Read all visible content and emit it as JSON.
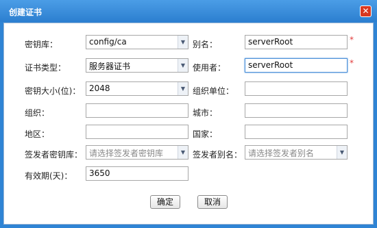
{
  "window": {
    "title": "创建证书"
  },
  "form": {
    "keystore": {
      "label": "密钥库：",
      "value": "config/ca"
    },
    "alias": {
      "label": "别名：",
      "value": "serverRoot",
      "required": "*"
    },
    "cert_type": {
      "label": "证书类型：",
      "value": "服务器证书"
    },
    "user": {
      "label": "使用者：",
      "value": "serverRoot",
      "required": "*"
    },
    "key_size": {
      "label": "密钥大小(位)：",
      "value": "2048"
    },
    "org_unit": {
      "label": "组织单位：",
      "value": ""
    },
    "org": {
      "label": "组织：",
      "value": ""
    },
    "city": {
      "label": "城市：",
      "value": ""
    },
    "region": {
      "label": "地区：",
      "value": ""
    },
    "country": {
      "label": "国家：",
      "value": ""
    },
    "issuer_keystore": {
      "label": "签发者密钥库：",
      "placeholder": "请选择签发者密钥库"
    },
    "issuer_alias": {
      "label": "签发者别名：",
      "placeholder": "请选择签发者别名"
    },
    "validity": {
      "label": "有效期(天)：",
      "value": "3650"
    }
  },
  "buttons": {
    "ok": "确定",
    "cancel": "取消"
  },
  "icons": {
    "close": "close-icon",
    "dropdown": "chevron-down-icon"
  },
  "colors": {
    "titlebar": "#2c7fd0",
    "required": "#e23a3a"
  }
}
